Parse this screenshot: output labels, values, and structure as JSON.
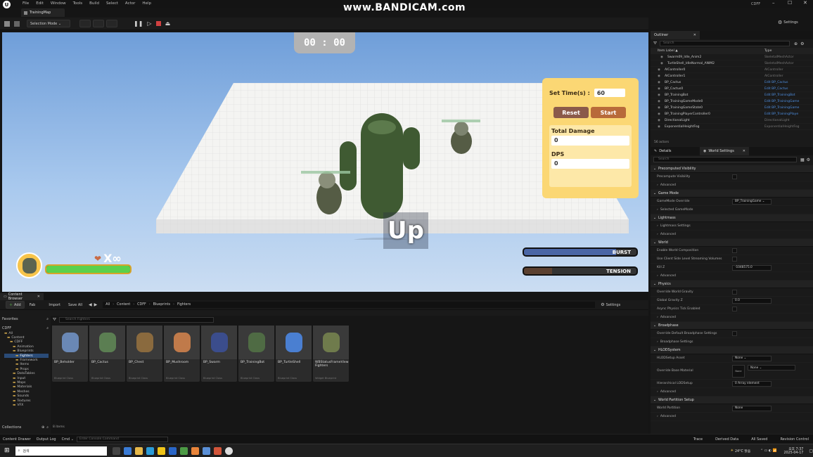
{
  "menubar": {
    "items": [
      "File",
      "Edit",
      "Window",
      "Tools",
      "Build",
      "Select",
      "Actor",
      "Help"
    ],
    "project": "CDFF",
    "tab_title": "TrainingMap"
  },
  "watermark": "www.BANDICAM.com",
  "toolbar": {
    "selection_mode": "Selection Mode",
    "settings": "Settings"
  },
  "hud": {
    "timer": "00 : 00",
    "set_time_label": "Set Time(s) :",
    "set_time_value": "60",
    "reset": "Reset",
    "start": "Start",
    "total_damage_label": "Total Damage",
    "total_damage_value": "0",
    "dps_label": "DPS",
    "dps_value": "0",
    "lives": "X∞",
    "center_text": "Up",
    "burst": "BURST",
    "tension": "TENSION",
    "health_fill": 1.0,
    "burst_fill": 0.82,
    "tension_fill": 0.25
  },
  "outliner": {
    "tab": "Outliner",
    "search_placeholder": "Search",
    "col_label": "Item Label ▲",
    "col_type": "Type",
    "items": [
      {
        "label": "Swarm09_Idle_Anim2",
        "type": "SkeletalMeshActor"
      },
      {
        "label": "TurtleShell_IdleNormal_ANIM2",
        "type": "SkeletalMeshActor"
      },
      {
        "label": "AIController0",
        "type": "AIController"
      },
      {
        "label": "AIController1",
        "type": "AIController"
      },
      {
        "label": "BP_Cactus",
        "type": "Edit BP_Cactus"
      },
      {
        "label": "BP_Cactus0",
        "type": "Edit BP_Cactus"
      },
      {
        "label": "BP_TrainingBot",
        "type": "Edit BP_TrainingBot"
      },
      {
        "label": "BP_TrainingGameMode0",
        "type": "Edit BP_TrainingGame"
      },
      {
        "label": "BP_TrainingGameState0",
        "type": "Edit BP_TrainingGame"
      },
      {
        "label": "BP_TrainingPlayerController0",
        "type": "Edit BP_TrainingPlaye"
      },
      {
        "label": "DirectionalLight",
        "type": "DirectionalLight"
      },
      {
        "label": "ExponentialHeightFog",
        "type": "ExponentialHeightFog"
      }
    ],
    "count": "56 actors"
  },
  "details": {
    "tab_details": "Details",
    "tab_world": "World Settings",
    "search_placeholder": "Search",
    "rows": [
      {
        "kind": "sec",
        "label": "Precomputed Visibility"
      },
      {
        "kind": "prop",
        "label": "Precompute Visibility",
        "ctl": "chk"
      },
      {
        "kind": "sub",
        "label": "Advanced"
      },
      {
        "kind": "sec",
        "label": "Game Mode"
      },
      {
        "kind": "prop",
        "label": "GameMode Override",
        "ctl": "val",
        "value": "BP_TrainingGame ⌄"
      },
      {
        "kind": "sub",
        "label": "Selected GameMode"
      },
      {
        "kind": "sec",
        "label": "Lightmass"
      },
      {
        "kind": "sub",
        "label": "Lightmass Settings"
      },
      {
        "kind": "sub",
        "label": "Advanced"
      },
      {
        "kind": "sec",
        "label": "World"
      },
      {
        "kind": "prop",
        "label": "Enable World Composition",
        "ctl": "chk"
      },
      {
        "kind": "prop",
        "label": "Use Client Side Level Streaming Volumes",
        "ctl": "chk"
      },
      {
        "kind": "prop",
        "label": "Kill Z",
        "ctl": "val",
        "value": "-1048575.0"
      },
      {
        "kind": "sub",
        "label": "Advanced"
      },
      {
        "kind": "sec",
        "label": "Physics"
      },
      {
        "kind": "prop",
        "label": "Override World Gravity",
        "ctl": "chk"
      },
      {
        "kind": "prop",
        "label": "Global Gravity Z",
        "ctl": "val",
        "value": "0.0"
      },
      {
        "kind": "prop",
        "label": "Async Physics Tick Enabled",
        "ctl": "chk"
      },
      {
        "kind": "sub",
        "label": "Advanced"
      },
      {
        "kind": "sec",
        "label": "Broadphase"
      },
      {
        "kind": "prop",
        "label": "Override Default Broadphase Settings",
        "ctl": "chk"
      },
      {
        "kind": "sub",
        "label": "Broadphase Settings"
      },
      {
        "kind": "sec",
        "label": "HLODSystem"
      },
      {
        "kind": "prop",
        "label": "HLODSetup Asset",
        "ctl": "val",
        "value": "None ⌄"
      },
      {
        "kind": "tall",
        "label": "Override Base Material",
        "value": "None ⌄"
      },
      {
        "kind": "prop",
        "label": "Hierarchical LODSetup",
        "ctl": "val",
        "value": "0 Array element"
      },
      {
        "kind": "sub",
        "label": "Advanced"
      },
      {
        "kind": "sec",
        "label": "World Partition Setup"
      },
      {
        "kind": "prop",
        "label": "World Partition",
        "ctl": "val",
        "value": "None"
      },
      {
        "kind": "sub",
        "label": "Advanced"
      }
    ]
  },
  "content_browser": {
    "tab": "Content Browser",
    "add": "Add",
    "fab": "Fab",
    "import": "Import",
    "save_all": "Save All",
    "path": [
      "All",
      "Content",
      "CDFF",
      "Blueprints",
      "Fighters"
    ],
    "settings": "Settings",
    "search_placeholder": "Search Fighters",
    "favorites": "Favorites",
    "root": "CDFF",
    "tree": [
      "All",
      "Content",
      "CDFF",
      "Animation",
      "Blueprints",
      "Fighters",
      "Framework",
      "Items",
      "Props",
      "DataTables",
      "Input",
      "Maps",
      "Materials",
      "Meshes",
      "Sounds",
      "Textures",
      "VFX"
    ],
    "collections": "Collections",
    "item_count": "8 items",
    "assets": [
      {
        "name": "BP_Beholder",
        "type": "Blueprint Class",
        "color": "#6a88b5"
      },
      {
        "name": "BP_Cactus",
        "type": "Blueprint Class",
        "color": "#5b7e52"
      },
      {
        "name": "BP_Chest",
        "type": "Blueprint Class",
        "color": "#8a6a3e"
      },
      {
        "name": "BP_Mushroom",
        "type": "Blueprint Class",
        "color": "#c07a4a"
      },
      {
        "name": "BP_Swarm",
        "type": "Blueprint Class",
        "color": "#3b4d8c"
      },
      {
        "name": "BP_TrainingBot",
        "type": "Blueprint Class",
        "color": "#4f6b44"
      },
      {
        "name": "BP_TurtleShell",
        "type": "Blueprint Class",
        "color": "#4a7fd1"
      },
      {
        "name": "WBStatusFrameView Fighters",
        "type": "Widget Blueprint",
        "color": "#6f7b4c"
      }
    ]
  },
  "statusbar": {
    "content_drawer": "Content Drawer",
    "output_log": "Output Log",
    "cmd": "Cmd",
    "cmd_placeholder": "Enter Console Command",
    "trace": "Trace",
    "derived_data": "Derived Data",
    "all_saved": "All Saved",
    "revision": "Revision Control"
  },
  "taskbar": {
    "search_placeholder": "검색",
    "weather": "24°C 맑음",
    "time": "오후 7:37",
    "date": "2025-04-17"
  }
}
